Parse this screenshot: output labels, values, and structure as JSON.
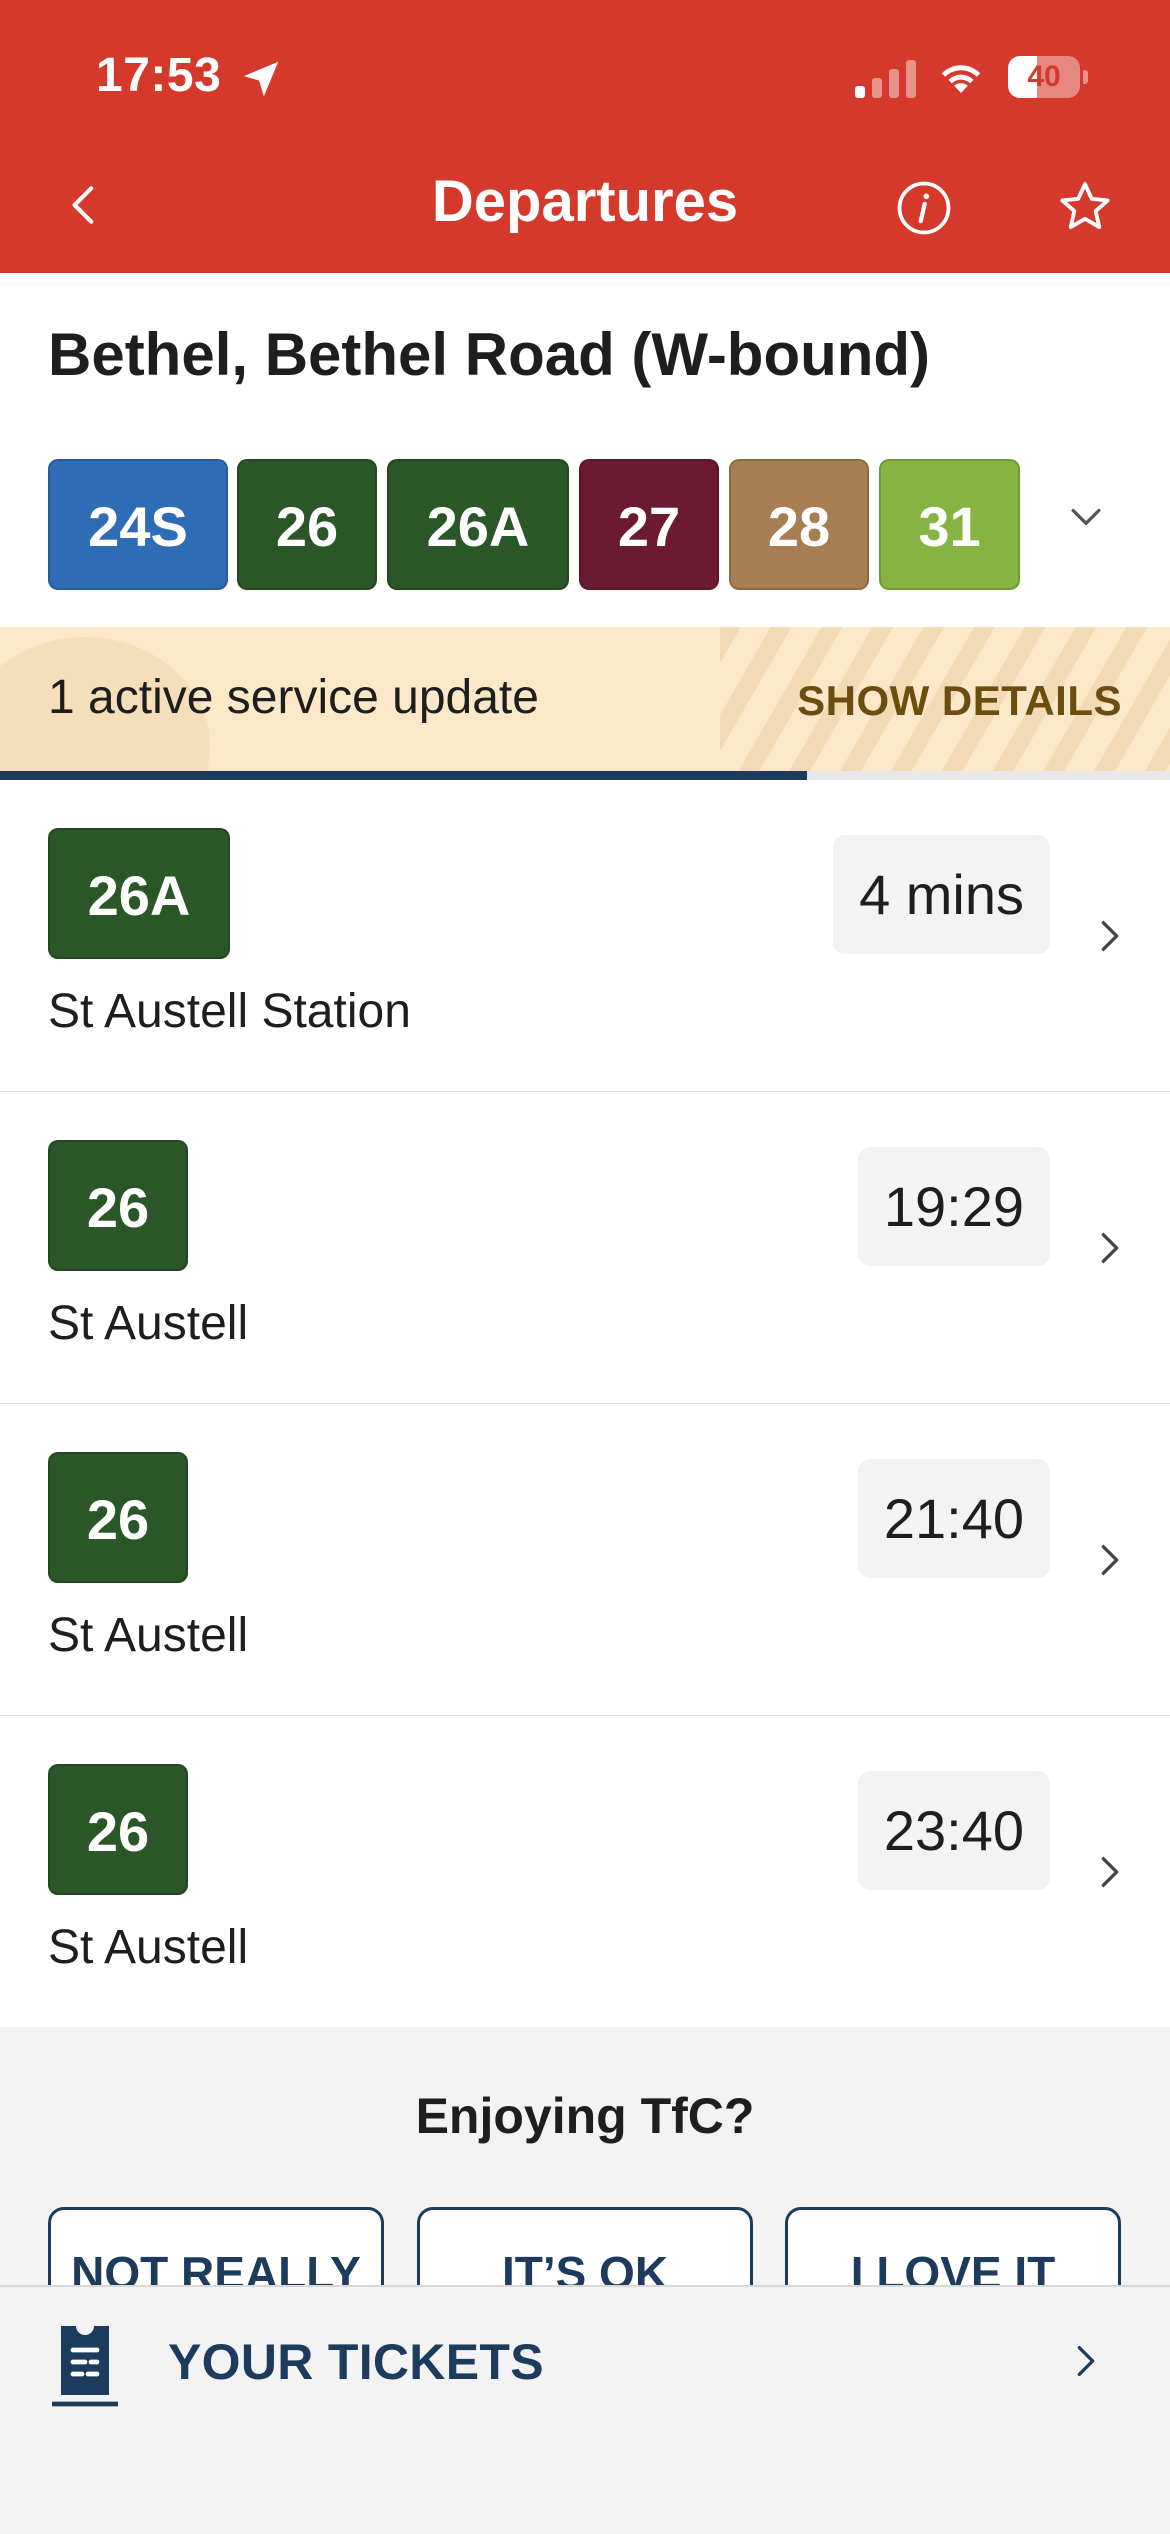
{
  "status_bar": {
    "time": "17:53",
    "battery": "40",
    "battery_level": 0.4
  },
  "nav": {
    "title": "Departures"
  },
  "stop": {
    "name": "Bethel, Bethel Road (W-bound)"
  },
  "routes": [
    {
      "label": "24S",
      "color": "#2e6db5"
    },
    {
      "label": "26",
      "color": "#2a5628"
    },
    {
      "label": "26A",
      "color": "#2a5628"
    },
    {
      "label": "27",
      "color": "#6b1a32"
    },
    {
      "label": "28",
      "color": "#a67e52"
    },
    {
      "label": "31",
      "color": "#86b342"
    }
  ],
  "service_update": {
    "text": "1 active service update",
    "action": "SHOW DETAILS",
    "progress": 0.69
  },
  "departures": [
    {
      "route": "26A",
      "destination": "St Austell Station",
      "time": "4 mins"
    },
    {
      "route": "26",
      "destination": "St Austell",
      "time": "19:29"
    },
    {
      "route": "26",
      "destination": "St Austell",
      "time": "21:40"
    },
    {
      "route": "26",
      "destination": "St Austell",
      "time": "23:40"
    }
  ],
  "feedback": {
    "title": "Enjoying TfC?",
    "buttons": [
      "NOT REALLY",
      "IT’S OK",
      "I LOVE IT"
    ]
  },
  "tickets": {
    "label": "YOUR TICKETS"
  }
}
